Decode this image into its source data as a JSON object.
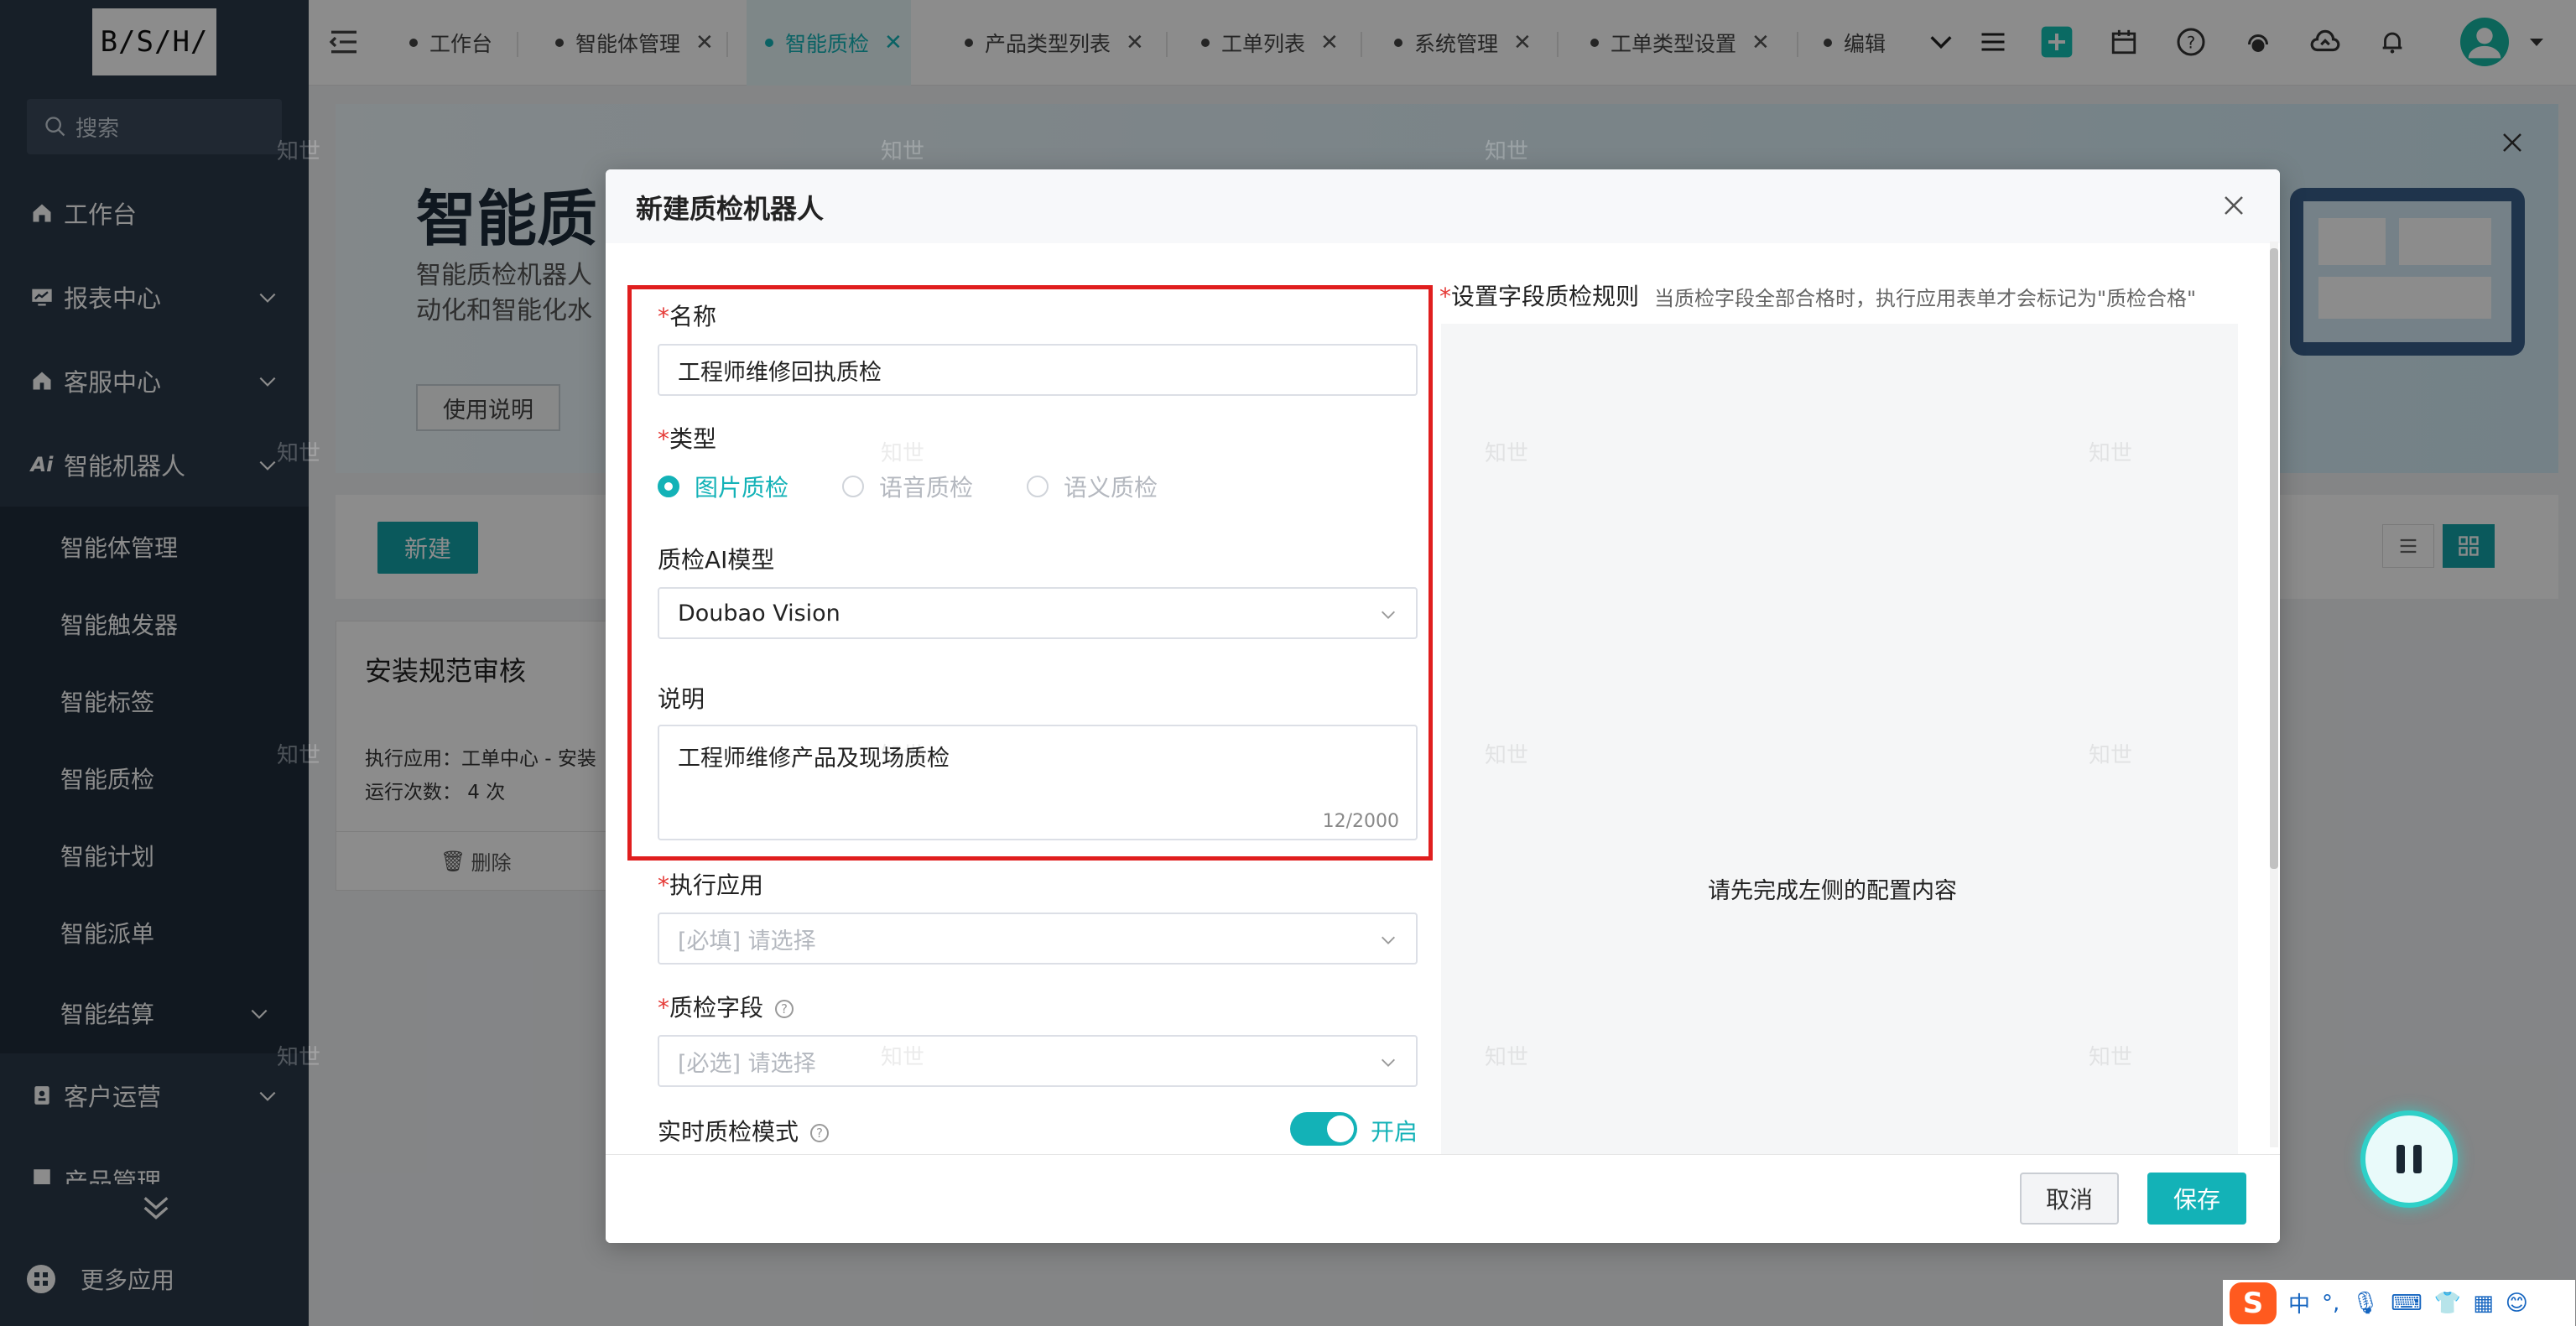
{
  "sidebar": {
    "logo": "B/S/H/",
    "search_placeholder": "搜索",
    "items": [
      {
        "label": "工作台"
      },
      {
        "label": "报表中心"
      },
      {
        "label": "客服中心"
      },
      {
        "label": "智能机器人"
      },
      {
        "label": "客户运营"
      },
      {
        "label": "产品管理"
      }
    ],
    "submenu": [
      "智能体管理",
      "智能触发器",
      "智能标签",
      "智能质检",
      "智能计划",
      "智能派单",
      "智能结算"
    ],
    "more_apps": "更多应用"
  },
  "tabs": [
    {
      "label": "工作台",
      "closable": false
    },
    {
      "label": "智能体管理",
      "closable": true
    },
    {
      "label": "智能质检",
      "closable": true,
      "active": true
    },
    {
      "label": "产品类型列表",
      "closable": true
    },
    {
      "label": "工单列表",
      "closable": true
    },
    {
      "label": "系统管理",
      "closable": true
    },
    {
      "label": "工单类型设置",
      "closable": true
    },
    {
      "label": "编辑",
      "closable": false
    }
  ],
  "page": {
    "banner_title": "智能质",
    "banner_desc_1": "智能质检机器人",
    "banner_desc_2": "动化和智能化水",
    "banner_button": "使用说明",
    "new_button": "新建",
    "card": {
      "title": "安装规范审核",
      "app_line": "执行应用：工单中心 - 安装",
      "runs_line": "运行次数： 4 次",
      "delete": "删除"
    },
    "watermark": "知世"
  },
  "modal": {
    "title": "新建质检机器人",
    "name_label": "名称",
    "name_value": "工程师维修回执质检",
    "type_label": "类型",
    "type_options": [
      {
        "label": "图片质检",
        "selected": true
      },
      {
        "label": "语音质检",
        "selected": false
      },
      {
        "label": "语义质检",
        "selected": false
      }
    ],
    "model_label": "质检AI模型",
    "model_value": "Doubao Vision",
    "desc_label": "说明",
    "desc_value": "工程师维修产品及现场质检",
    "desc_counter": "12/2000",
    "app_label": "执行应用",
    "app_placeholder": "[必填] 请选择",
    "fields_label": "质检字段",
    "fields_placeholder": "[必选] 请选择",
    "realtime_label": "实时质检模式",
    "realtime_state": "开启",
    "rules_title": "设置字段质检规则",
    "rules_hint": "当质检字段全部合格时，执行应用表单才会标记为\"质检合格\"",
    "rules_empty": "请先完成左侧的配置内容",
    "cancel": "取消",
    "save": "保存"
  },
  "ime": {
    "lang": "中"
  },
  "colors": {
    "accent": "#13b2b7",
    "sidebar": "#2b3a4a",
    "highlight": "#e01e1e"
  }
}
